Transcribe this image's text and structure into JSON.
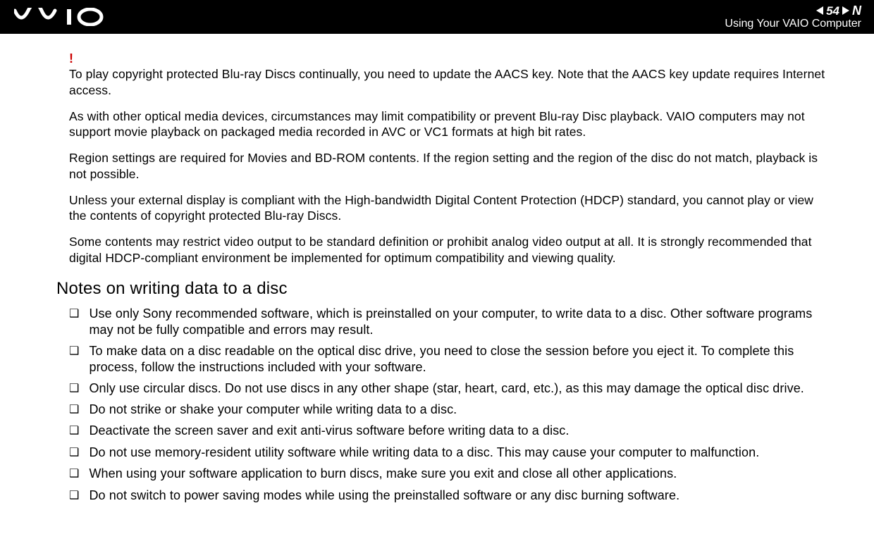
{
  "header": {
    "page_number": "54",
    "n_letter": "N",
    "section_title": "Using Your VAIO Computer"
  },
  "warning_mark": "!",
  "notes": [
    "To play copyright protected Blu-ray Discs continually, you need to update the AACS key. Note that the AACS key update requires Internet access.",
    "As with other optical media devices, circumstances may limit compatibility or prevent Blu-ray Disc playback. VAIO computers may not support movie playback on packaged media recorded in AVC or VC1 formats at high bit rates.",
    "Region settings are required for Movies and BD-ROM contents. If the region setting and the region of the disc do not match, playback is not possible.",
    "Unless your external display is compliant with the High-bandwidth Digital Content Protection (HDCP) standard, you cannot play or view the contents of copyright protected Blu-ray Discs.",
    "Some contents may restrict video output to be standard definition or prohibit analog video output at all. It is strongly recommended that digital HDCP-compliant environment be implemented for optimum compatibility and viewing quality."
  ],
  "section_heading": "Notes on writing data to a disc",
  "bullets": [
    "Use only Sony recommended software, which is preinstalled on your computer, to write data to a disc.\nOther software programs may not be fully compatible and errors may result.",
    "To make data on a disc readable on the optical disc drive, you need to close the session before you eject it. To complete this process, follow the instructions included with your software.",
    "Only use circular discs. Do not use discs in any other shape (star, heart, card, etc.), as this may damage the optical disc drive.",
    "Do not strike or shake your computer while writing data to a disc.",
    "Deactivate the screen saver and exit anti-virus software before writing data to a disc.",
    "Do not use memory-resident utility software while writing data to a disc. This may cause your computer to malfunction.",
    "When using your software application to burn discs, make sure you exit and close all other applications.",
    "Do not switch to power saving modes while using the preinstalled software or any disc burning software."
  ],
  "bullet_marker": "❑"
}
